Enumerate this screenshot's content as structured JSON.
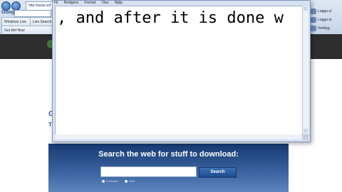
{
  "browser": {
    "address_text": "http://www.sof",
    "google_label": "Google",
    "tabs": [
      {
        "label": "Windows Live"
      },
      {
        "label": "Live Search"
      },
      {
        "label": "Get Ref Now"
      }
    ],
    "right_labels": [
      "Logga ut",
      "Logga ut",
      "Verktyg"
    ]
  },
  "site": {
    "heading": "G",
    "subheading": "T",
    "small": "..."
  },
  "search_panel": {
    "title": "Search the web for stuff to download:",
    "search_value": "",
    "button_label": "Search",
    "option_1": "Freeware",
    "option_2": "Web"
  },
  "notepad": {
    "menu": [
      "Fil",
      "Redigera",
      "Format",
      "Visa",
      "Hjälp"
    ],
    "content": ", and after it is done w"
  }
}
